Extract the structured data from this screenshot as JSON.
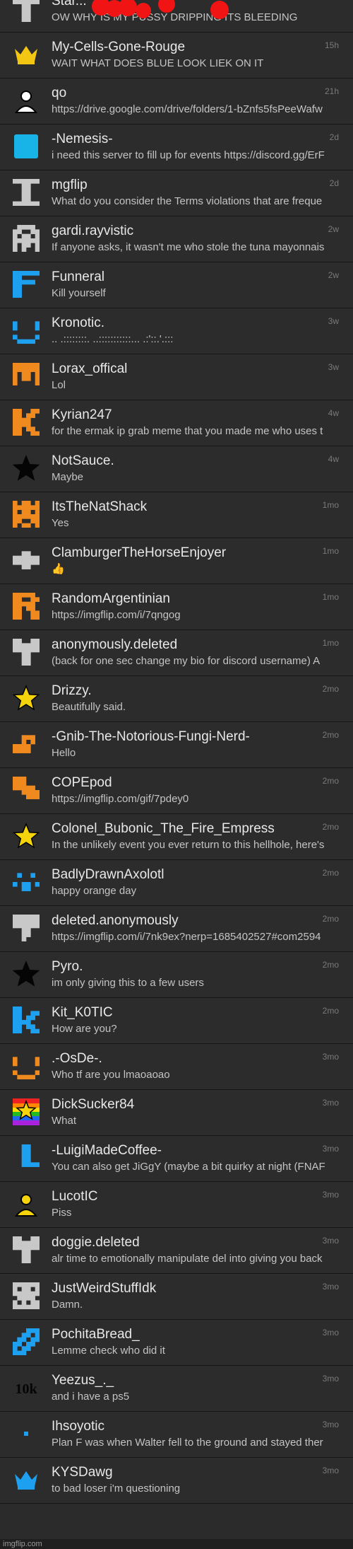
{
  "conversations": [
    {
      "name": "Star...",
      "preview": "OW WHY IS MY PUSSY DRIPPING ITS BLEEDING",
      "time": "",
      "avatar": "grey-t-icon",
      "shape": "t",
      "color": "#c8c8c8"
    },
    {
      "name": "My-Cells-Gone-Rouge",
      "preview": "WAIT WHAT DOES BLUE LOOK LIEK ON IT",
      "time": "15h",
      "avatar": "crown-icon",
      "shape": "crown",
      "color": "#f3c614"
    },
    {
      "name": "qo",
      "preview": "https://drive.google.com/drive/folders/1-bZnfs5fsPeeWafw",
      "time": "21h",
      "avatar": "person-icon",
      "shape": "person",
      "color": "#ffffff"
    },
    {
      "name": "-Nemesis-",
      "preview": "i need this server to fill up for events https://discord.gg/ErF",
      "time": "2d",
      "avatar": "blue-square-icon",
      "shape": "square",
      "color": "#18b4e8"
    },
    {
      "name": "mgflip",
      "preview": "What do you consider the Terms violations that are freque",
      "time": "2d",
      "avatar": "i-beam-icon",
      "shape": "ibeam",
      "color": "#c8c8c8"
    },
    {
      "name": "gardi.rayvistic",
      "preview": "If anyone asks, it wasn't me who stole the tuna mayonnais",
      "time": "2w",
      "avatar": "pixel-ghost-icon",
      "shape": "ghost",
      "color": "#c8c8c8"
    },
    {
      "name": "Funneral",
      "preview": "Kill yourself",
      "time": "2w",
      "avatar": "letter-f-icon",
      "shape": "letterf",
      "color": "#1ea0f0"
    },
    {
      "name": "Kronotic.",
      "preview": "  .. .::::::::.       ..:::::::::::...   .:'::.'.:::",
      "time": "3w",
      "avatar": "smiley-icon",
      "shape": "smiley",
      "color": "#1ea0f0"
    },
    {
      "name": "Lorax_offical",
      "preview": "Lol",
      "time": "3w",
      "avatar": "pixel-octopus-icon",
      "shape": "octopus",
      "color": "#f08a1e"
    },
    {
      "name": "Kyrian247",
      "preview": "for the ermak ip grab meme that you made me who uses t",
      "time": "4w",
      "avatar": "letter-k-icon",
      "shape": "letterk",
      "color": "#f08a1e"
    },
    {
      "name": "NotSauce.",
      "preview": "Maybe",
      "time": "4w",
      "avatar": "black-star-icon",
      "shape": "star",
      "color": "#050505"
    },
    {
      "name": "ItsTheNatShack",
      "preview": "Yes",
      "time": "1mo",
      "avatar": "pixel-invader-icon",
      "shape": "invader",
      "color": "#f08a1e"
    },
    {
      "name": "ClamburgerTheHorseEnjoyer",
      "preview": "👍",
      "time": "1mo",
      "avatar": "pixel-car-icon",
      "shape": "car",
      "color": "#c8c8c8"
    },
    {
      "name": "RandomArgentinian",
      "preview": "https://imgflip.com/i/7qngog",
      "time": "1mo",
      "avatar": "letter-r-icon",
      "shape": "letterr",
      "color": "#f08a1e"
    },
    {
      "name": "anonymously.deleted",
      "preview": "(back for one sec change my bio for discord username) A",
      "time": "1mo",
      "avatar": "t-shirt-icon",
      "shape": "shirt",
      "color": "#c8c8c8"
    },
    {
      "name": "Drizzy.",
      "preview": "Beautifully said.",
      "time": "2mo",
      "avatar": "yellow-star-icon",
      "shape": "star",
      "color": "#f5d40c"
    },
    {
      "name": "-Gnib-The-Notorious-Fungi-Nerd-",
      "preview": "Hello",
      "time": "2mo",
      "avatar": "pixel-blob-icon",
      "shape": "blob",
      "color": "#f08a1e"
    },
    {
      "name": "COPEpod",
      "preview": "https://imgflip.com/gif/7pdey0",
      "time": "2mo",
      "avatar": "pixel-stairs-icon",
      "shape": "stairs",
      "color": "#f08a1e"
    },
    {
      "name": "Colonel_Bubonic_The_Fire_Empress",
      "preview": "In the unlikely event you ever return to this hellhole, here's",
      "time": "2mo",
      "avatar": "yellow-star-icon",
      "shape": "star",
      "color": "#f5d40c"
    },
    {
      "name": "BadlyDrawnAxolotl",
      "preview": "happy orange day",
      "time": "2mo",
      "avatar": "pixel-face-icon",
      "shape": "face",
      "color": "#1ea0f0"
    },
    {
      "name": "deleted.anonymously",
      "preview": "https://imgflip.com/i/7nk9ex?nerp=1685402527#com2594",
      "time": "2mo",
      "avatar": "pixel-flag-icon",
      "shape": "flag",
      "color": "#c8c8c8"
    },
    {
      "name": "Pyro.",
      "preview": "im only giving this to a few users",
      "time": "2mo",
      "avatar": "black-star-icon",
      "shape": "star",
      "color": "#050505"
    },
    {
      "name": "Kit_K0TIC",
      "preview": "How are you?",
      "time": "2mo",
      "avatar": "letter-k-icon",
      "shape": "letterk2",
      "color": "#1ea0f0"
    },
    {
      "name": ".-OsDe-.",
      "preview": "Who tf are you lmaoaoao",
      "time": "3mo",
      "avatar": "smiley-icon",
      "shape": "smiley",
      "color": "#f08a1e"
    },
    {
      "name": "DickSucker84",
      "preview": "What",
      "time": "3mo",
      "avatar": "rainbow-star-icon",
      "shape": "rainbow",
      "color": "#f5d40c"
    },
    {
      "name": "-LuigiMadeCoffee-",
      "preview": "You can also get JiGgY (maybe a bit quirky at night (FNAF",
      "time": "3mo",
      "avatar": "letter-l-icon",
      "shape": "letterl",
      "color": "#1ea0f0"
    },
    {
      "name": "LucotIC",
      "preview": "Piss",
      "time": "3mo",
      "avatar": "person-icon",
      "shape": "person",
      "color": "#f5d40c"
    },
    {
      "name": "doggie.deleted",
      "preview": "alr time to emotionally manipulate del into giving you back",
      "time": "3mo",
      "avatar": "t-shirt-icon",
      "shape": "shirt",
      "color": "#c8c8c8"
    },
    {
      "name": "JustWeirdStuffIdk",
      "preview": "Damn.",
      "time": "3mo",
      "avatar": "pixel-skull-icon",
      "shape": "skull",
      "color": "#c8c8c8"
    },
    {
      "name": "PochitaBread_",
      "preview": "Lemme check who did it",
      "time": "3mo",
      "avatar": "pixel-diagonal-icon",
      "shape": "diagonal",
      "color": "#1ea0f0"
    },
    {
      "name": "Yeezus_._",
      "preview": "and i have a ps5",
      "time": "3mo",
      "avatar": "10k-badge-icon",
      "shape": "text10k",
      "color": "#050505"
    },
    {
      "name": "Ihsoyotic",
      "preview": "Plan F was when Walter fell to the ground and stayed ther",
      "time": "3mo",
      "avatar": "dot-icon",
      "shape": "dot",
      "color": "#1ea0f0"
    },
    {
      "name": "KYSDawg",
      "preview": "to bad loser i'm questioning",
      "time": "3mo",
      "avatar": "blue-crown-icon",
      "shape": "crown",
      "color": "#1ea0f0"
    }
  ],
  "footer": {
    "watermark": "imgflip.com"
  },
  "colors": {
    "background": "#2c2c2c",
    "divider": "#151515",
    "name": "#e8e8e8",
    "preview": "#c4c4c4",
    "time": "#7a7a7a",
    "redaction": "#f01414"
  }
}
